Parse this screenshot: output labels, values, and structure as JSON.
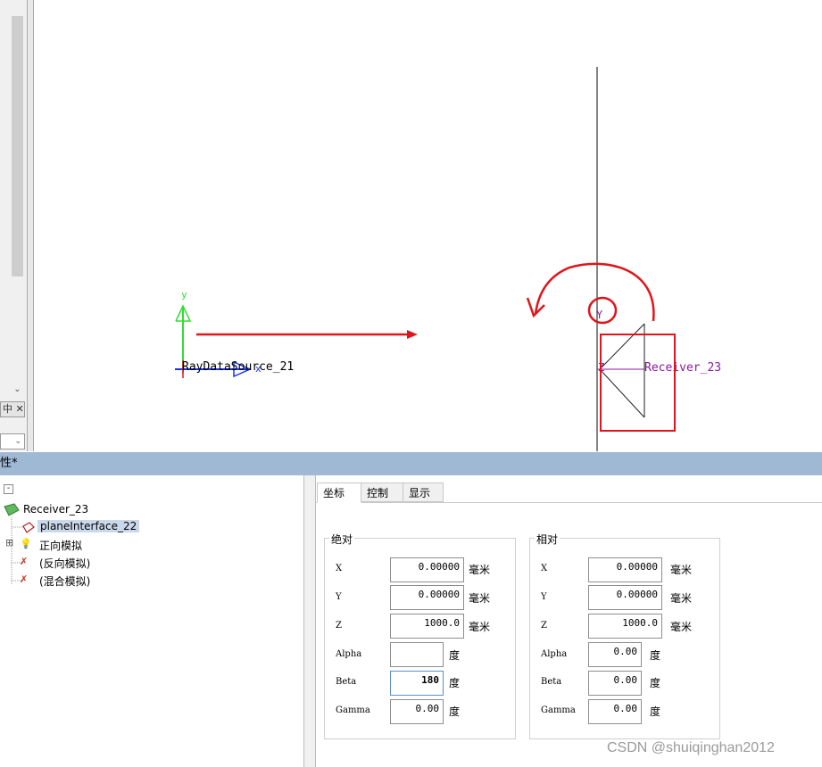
{
  "viewport": {
    "source_name": "RayDataSource_21",
    "source_axis_y": "y",
    "source_axis_x": "x",
    "receiver_name": "Receiver_23",
    "receiver_axis_y": "Y",
    "receiver_axis_z": "Z"
  },
  "left_strip": {
    "down_arrow": "⌄",
    "tab_glyph": "中 ✕",
    "dropdown_glyph": "⌄"
  },
  "panel": {
    "title": "性*",
    "collapse_symbol": "-"
  },
  "tree": {
    "root": "Receiver_23",
    "children": [
      {
        "label": "planeInterface_22",
        "selected": true,
        "icon": "plane-interface-icon"
      },
      {
        "label": "正向模拟",
        "expand": "⊞",
        "icon": "bulb-icon"
      },
      {
        "label": "(反向模拟)",
        "icon": "bulb-disabled-icon"
      },
      {
        "label": "(混合模拟)",
        "icon": "bulb-disabled-icon"
      }
    ]
  },
  "tabs": [
    {
      "label": "坐标",
      "active": true
    },
    {
      "label": "控制",
      "active": false
    },
    {
      "label": "显示",
      "active": false
    }
  ],
  "absolute": {
    "title": "绝对",
    "fields": [
      {
        "label": "X",
        "value": "0.00000",
        "unit": "毫米"
      },
      {
        "label": "Y",
        "value": "0.00000",
        "unit": "毫米"
      },
      {
        "label": "Z",
        "value": "1000.0",
        "unit": "毫米"
      },
      {
        "label": "Alpha",
        "value": "",
        "unit": "度"
      },
      {
        "label": "Beta",
        "value": "180",
        "unit": "度"
      },
      {
        "label": "Gamma",
        "value": "0.00",
        "unit": "度"
      }
    ]
  },
  "relative": {
    "title": "相对",
    "fields": [
      {
        "label": "X",
        "value": "0.00000",
        "unit": "毫米"
      },
      {
        "label": "Y",
        "value": "0.00000",
        "unit": "毫米"
      },
      {
        "label": "Z",
        "value": "1000.0",
        "unit": "毫米"
      },
      {
        "label": "Alpha",
        "value": "0.00",
        "unit": "度"
      },
      {
        "label": "Beta",
        "value": "0.00",
        "unit": "度"
      },
      {
        "label": "Gamma",
        "value": "0.00",
        "unit": "度"
      }
    ]
  },
  "colors": {
    "annotation_red": "#e0151b",
    "axis_green": "#33dd33",
    "axis_blue": "#1a33e6",
    "receiver_purple": "#8a1a9c"
  },
  "watermark": "CSDN @shuiqinghan2012"
}
